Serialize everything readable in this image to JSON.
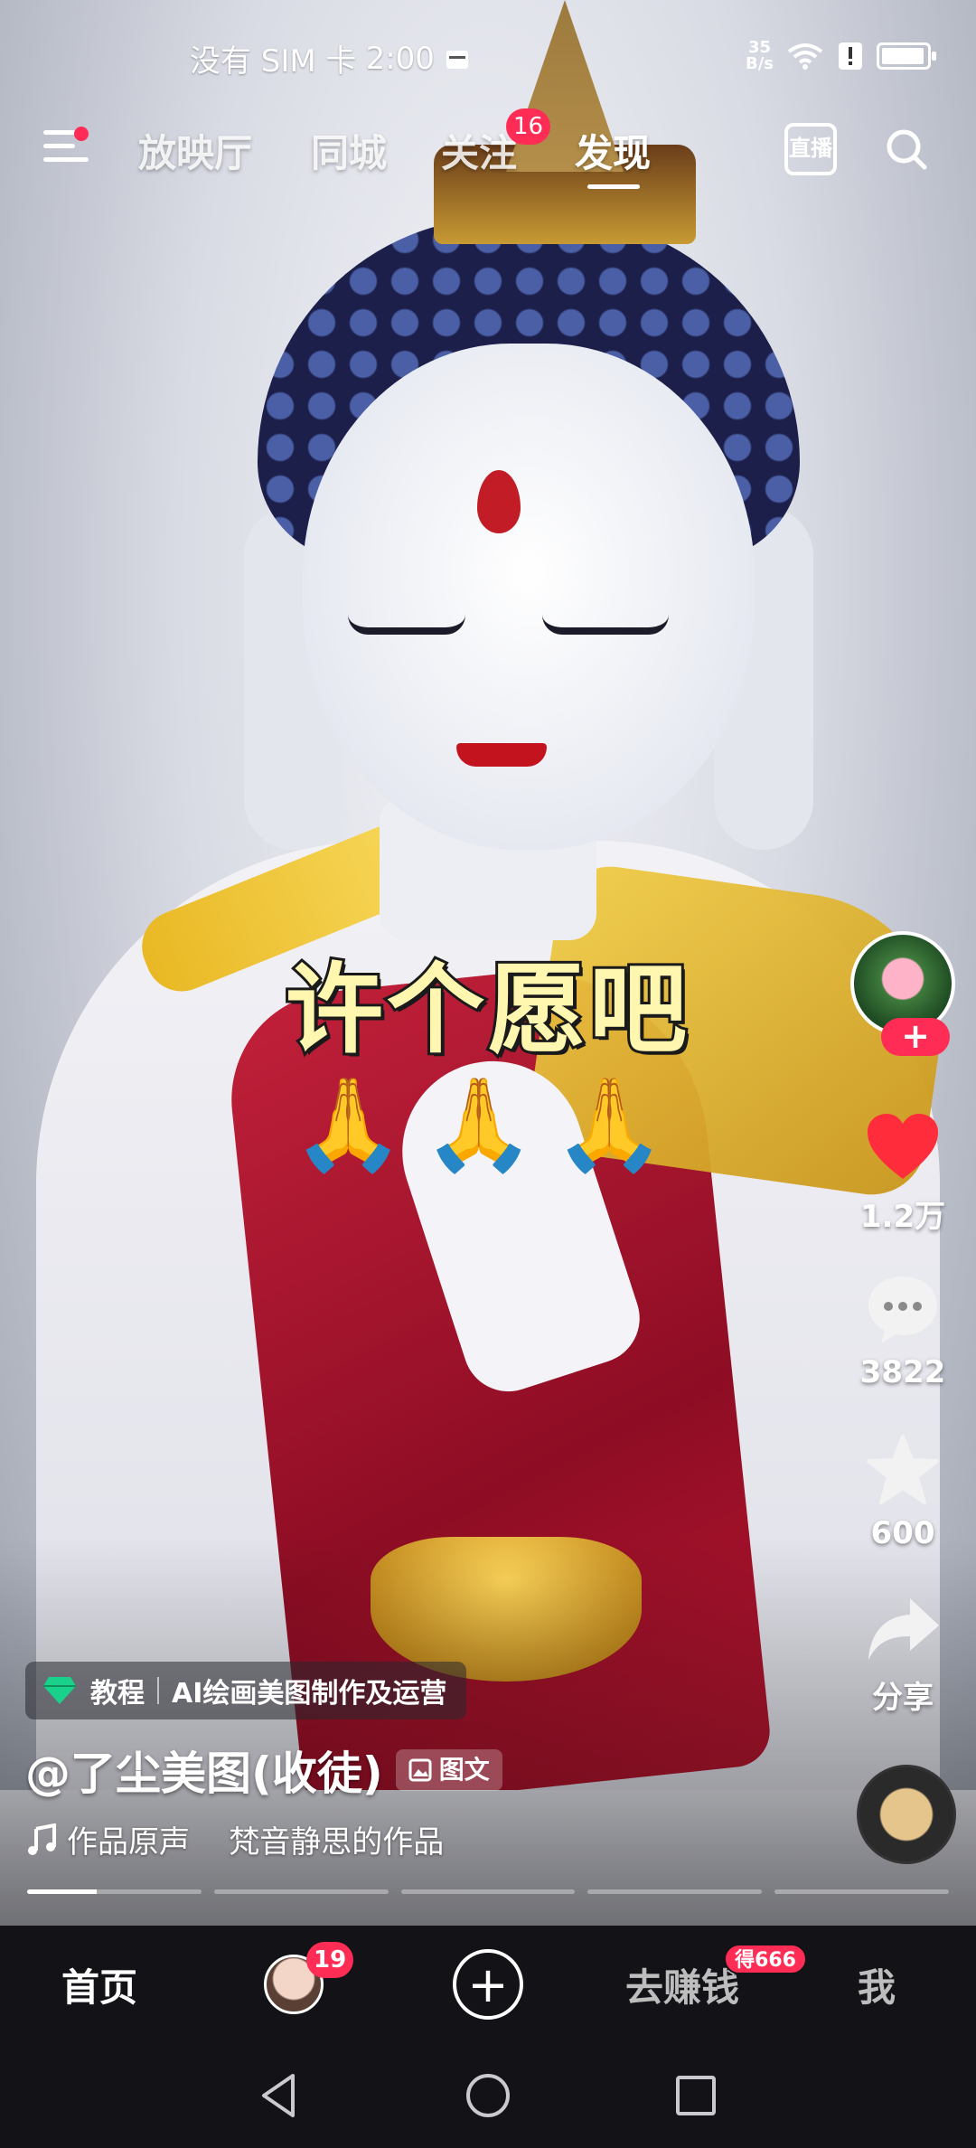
{
  "status_bar": {
    "carrier": "没有 SIM 卡",
    "time": "2:00",
    "net_speed_top": "35",
    "net_speed_bottom": "B/s",
    "battery_level": 0.95
  },
  "top_nav": {
    "tabs": [
      {
        "label": "放映厅",
        "active": false
      },
      {
        "label": "同城",
        "active": false
      },
      {
        "label": "关注",
        "active": false,
        "badge": "16"
      },
      {
        "label": "发现",
        "active": true
      }
    ],
    "live_label": "直播"
  },
  "video": {
    "caption": "许个愿吧",
    "emojis": "🙏🙏🙏",
    "tag_label": "教程",
    "tag_title": "AI绘画美图制作及运营",
    "author": "@了尘美图(收徒)",
    "kind_badge": "图文",
    "music": "作品原声    梵音静思的作品",
    "progress_segments": 5,
    "progress_current": 0.4
  },
  "rail": {
    "follow_symbol": "+",
    "likes": "1.2万",
    "comments": "3822",
    "favorites": "600",
    "share": "分享"
  },
  "bottom_tabs": {
    "home": "首页",
    "friends_badge": "19",
    "create": "+",
    "earn": "去赚钱",
    "earn_badge": "得666",
    "me": "我"
  },
  "colors": {
    "accent": "#ff2c55",
    "tabbar_bg": "#131217",
    "caption_fill": "#fff7b0"
  },
  "icons": [
    "menu-icon",
    "live-icon",
    "search-icon",
    "heart-icon",
    "comment-icon",
    "star-icon",
    "share-icon",
    "gem-icon",
    "image-text-icon",
    "music-note-icon",
    "back-icon",
    "home-circle-icon",
    "recents-icon"
  ]
}
